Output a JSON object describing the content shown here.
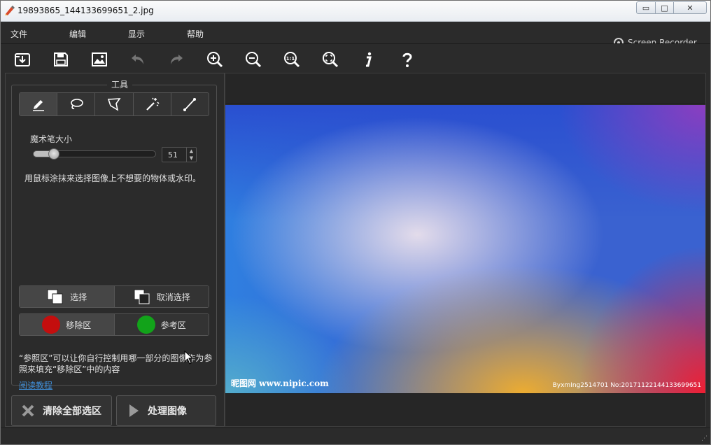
{
  "window": {
    "title": "19893865_144133699651_2.jpg",
    "controls": {
      "minimize": "▭",
      "maximize": "□",
      "close": "✕"
    }
  },
  "overlay": {
    "recorder_text": "Screen Recorder"
  },
  "menu": {
    "items": [
      "文件",
      "编辑",
      "显示",
      "帮助"
    ]
  },
  "toolbar": {
    "icons": [
      "open-icon",
      "save-icon",
      "save-image-icon",
      "undo-icon",
      "redo-icon",
      "zoom-in-icon",
      "zoom-out-icon",
      "actual-size-icon",
      "fit-window-icon",
      "info-icon",
      "help-icon"
    ]
  },
  "tools_panel": {
    "title": "工具",
    "tools": [
      "brush-icon",
      "lasso-icon",
      "polygon-lasso-icon",
      "magic-wand-icon",
      "line-icon"
    ],
    "brush_size_label": "魔术笔大小",
    "brush_size_value": "51",
    "brush_size_fraction": 0.12,
    "hint": "用鼠标涂抹来选择图像上不想要的物体或水印。",
    "select_label": "选择",
    "deselect_label": "取消选择",
    "remove_area_label": "移除区",
    "reference_area_label": "参考区",
    "remove_color": "#c40e0e",
    "reference_color": "#12a31a",
    "reference_hint": "“参照区”可以让你自行控制用哪一部分的图像作为参照来填充“移除区”中的内容",
    "tutorial_link": "阅读教程"
  },
  "actions": {
    "clear_all": "清除全部选区",
    "process": "处理图像"
  },
  "image": {
    "watermark_left": "昵图网 www.nipic.com",
    "watermark_right": "ByxmIng2514701 No:20171122144133699651"
  }
}
